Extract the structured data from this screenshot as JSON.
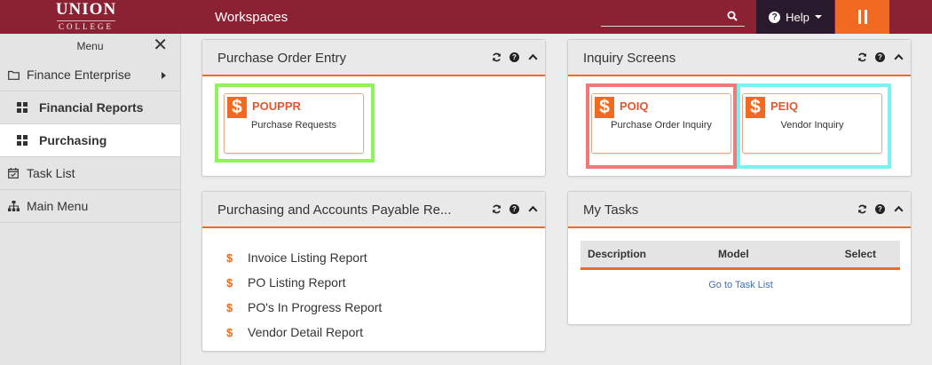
{
  "topbar": {
    "logo_line1": "UNION",
    "logo_line2": "COLLEGE",
    "workspace_title": "Workspaces",
    "search_placeholder": "",
    "help_label": "Help",
    "colors": {
      "bar": "#8a2233",
      "help_bg": "#2a1a2e",
      "accent": "#f26a21"
    }
  },
  "sidebar": {
    "menu_label": "Menu",
    "items": [
      {
        "label": "Finance Enterprise",
        "icon": "folder-icon",
        "level": 1,
        "has_submenu": true
      },
      {
        "label": "Financial Reports",
        "icon": "grid-icon",
        "level": 2
      },
      {
        "label": "Purchasing",
        "icon": "grid-icon",
        "level": 2,
        "active": true
      },
      {
        "label": "Task List",
        "icon": "calendar-check-icon",
        "level": 1
      },
      {
        "label": "Main Menu",
        "icon": "sitemap-icon",
        "level": 1
      }
    ]
  },
  "panels": {
    "purchase_order_entry": {
      "title": "Purchase Order Entry",
      "tiles": [
        {
          "code": "POUPPR",
          "description": "Purchase Requests",
          "highlight": "#8ef25b"
        }
      ]
    },
    "inquiry_screens": {
      "title": "Inquiry Screens",
      "tiles": [
        {
          "code": "POIQ",
          "description": "Purchase Order Inquiry",
          "highlight": "#f47878"
        },
        {
          "code": "PEIQ",
          "description": "Vendor Inquiry",
          "highlight": "#7af2f2"
        }
      ]
    },
    "reports": {
      "title": "Purchasing and Accounts Payable Re...",
      "items": [
        "Invoice Listing Report",
        "PO Listing Report",
        "PO's In Progress Report",
        "Vendor Detail Report"
      ]
    },
    "my_tasks": {
      "title": "My Tasks",
      "columns": [
        "Description",
        "Model",
        "Select"
      ],
      "link_label": "Go to Task List"
    }
  }
}
